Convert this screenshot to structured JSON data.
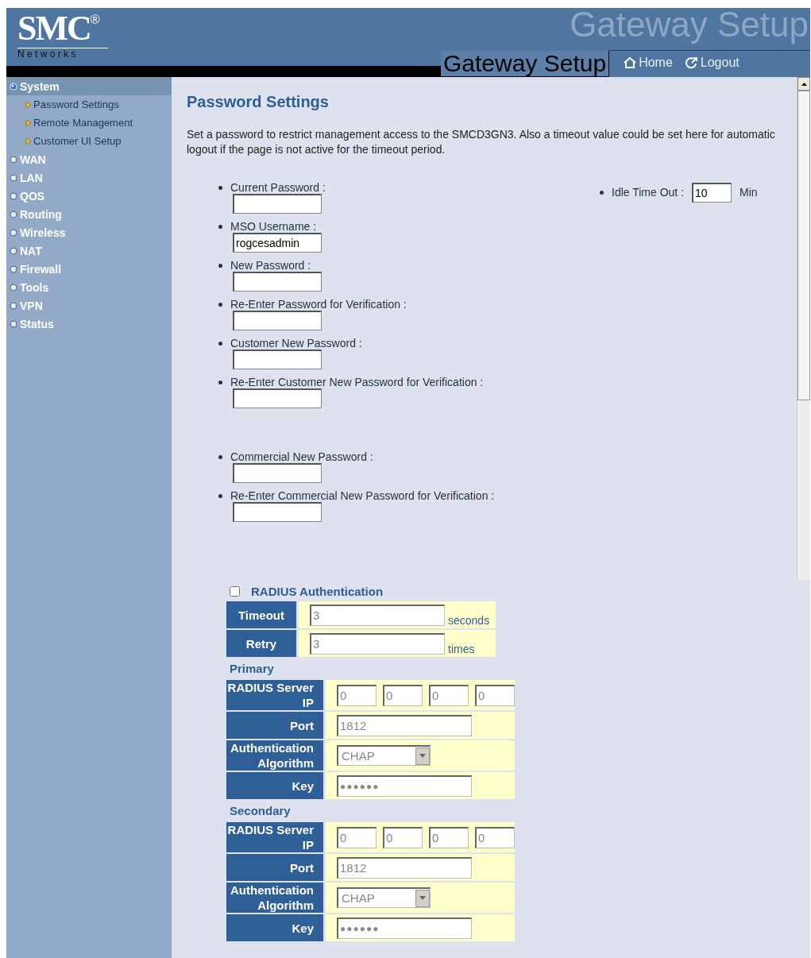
{
  "header": {
    "logo": "SMC",
    "logo_mark": "®",
    "logo_sub": "N e t w o r k s",
    "banner_text": "Gateway Setup",
    "title": "Gateway Setup",
    "links": [
      {
        "label": "Home",
        "kind": "home"
      },
      {
        "label": "Logout",
        "kind": "logout"
      }
    ]
  },
  "sidebar": {
    "items": [
      {
        "label": "System",
        "selected": true,
        "children": [
          {
            "label": "Password Settings"
          },
          {
            "label": "Remote Management"
          },
          {
            "label": "Customer UI Setup"
          }
        ]
      },
      {
        "label": "WAN",
        "selected": false
      },
      {
        "label": "LAN",
        "selected": false
      },
      {
        "label": "QOS",
        "selected": false
      },
      {
        "label": "Routing",
        "selected": false
      },
      {
        "label": "Wireless",
        "selected": false
      },
      {
        "label": "NAT",
        "selected": false
      },
      {
        "label": "Firewall",
        "selected": false
      },
      {
        "label": "Tools",
        "selected": false
      },
      {
        "label": "VPN",
        "selected": false
      },
      {
        "label": "Status",
        "selected": false
      }
    ]
  },
  "page": {
    "title": "Password Settings",
    "description": "Set a password to restrict management access to the SMCD3GN3. Also a timeout value could be set here for automatic logout if the page is not active for the timeout period.",
    "fields": [
      {
        "label": "Current Password :"
      },
      {
        "label": "MSO Username :",
        "value": "rogcesadmin"
      },
      {
        "label": "New Password :"
      },
      {
        "label": "Re-Enter Password for Verification :"
      },
      {
        "label": "Customer New Password :"
      },
      {
        "label": "Re-Enter Customer New Password for Verification :"
      },
      {
        "label": "Commercial New Password :",
        "gap": true
      },
      {
        "label": "Re-Enter Commercial New Password for Verification :"
      }
    ],
    "idle_timeout": {
      "label": "Idle Time Out :",
      "value": "10",
      "unit": "Min"
    }
  },
  "radius": {
    "label": "RADIUS Authentication",
    "checked": false,
    "settings": [
      {
        "label": "Timeout",
        "value": "3",
        "unit": "seconds"
      },
      {
        "label": "Retry",
        "value": "3",
        "unit": "times"
      }
    ],
    "servers": [
      {
        "title": "Primary",
        "rows": [
          {
            "kind": "ip",
            "label": "RADIUS Server IP",
            "values": [
              "0",
              "0",
              "0",
              "0"
            ]
          },
          {
            "kind": "text",
            "label": "Port",
            "value": "1812"
          },
          {
            "kind": "select",
            "label": "Authentication Algorithm",
            "value": "CHAP"
          },
          {
            "kind": "password",
            "label": "Key",
            "value": "●●●●●●"
          }
        ]
      },
      {
        "title": "Secondary",
        "rows": [
          {
            "kind": "ip",
            "label": "RADIUS Server IP",
            "values": [
              "0",
              "0",
              "0",
              "0"
            ]
          },
          {
            "kind": "text",
            "label": "Port",
            "value": "1812"
          },
          {
            "kind": "select",
            "label": "Authentication Algorithm",
            "value": "CHAP"
          },
          {
            "kind": "password",
            "label": "Key",
            "value": "●●●●●●"
          }
        ]
      }
    ]
  }
}
